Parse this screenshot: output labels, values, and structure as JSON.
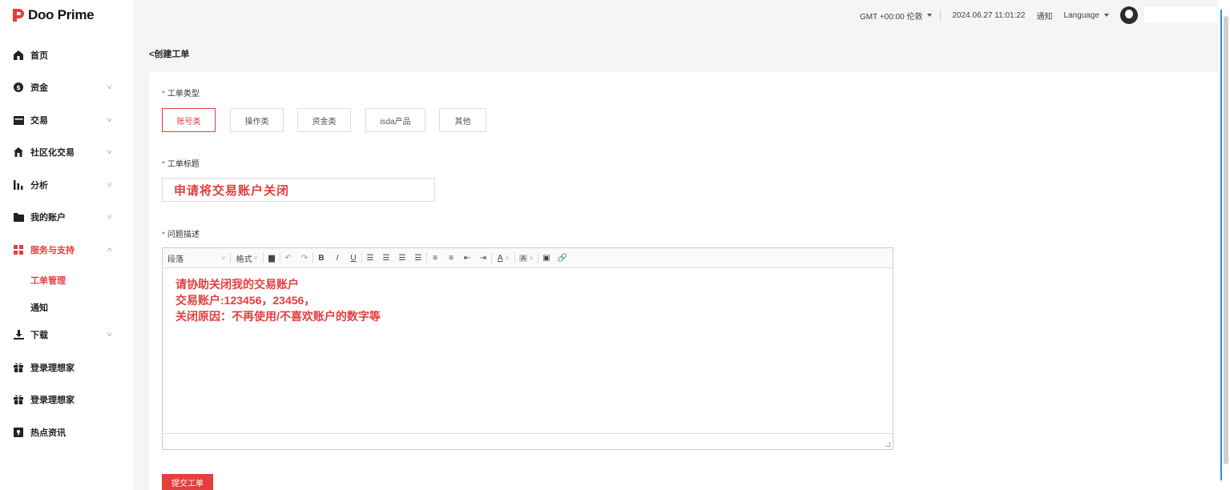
{
  "brand": {
    "name": "Doo Prime",
    "color": "#e53e3e"
  },
  "topbar": {
    "timezone": "GMT +00:00 伦敦",
    "datetime": "2024.06.27 11:01:22",
    "notice": "通知",
    "language": "Language"
  },
  "sidebar": {
    "items": [
      {
        "label": "首页",
        "icon": "home-icon"
      },
      {
        "label": "资金",
        "icon": "money-icon"
      },
      {
        "label": "交易",
        "icon": "card-icon"
      },
      {
        "label": "社区化交易",
        "icon": "house-icon"
      },
      {
        "label": "分析",
        "icon": "bars-icon"
      },
      {
        "label": "我的账户",
        "icon": "folder-icon"
      },
      {
        "label": "服务与支持",
        "icon": "grid-icon"
      },
      {
        "label": "下载",
        "icon": "download-icon"
      },
      {
        "label": "登录理想家",
        "icon": "gift-icon"
      },
      {
        "label": "登录理想家",
        "icon": "gift-icon"
      },
      {
        "label": "热点资讯",
        "icon": "news-icon"
      }
    ],
    "subitems": [
      {
        "label": "工单管理"
      },
      {
        "label": "通知"
      }
    ]
  },
  "page": {
    "back_title": "<创建工单",
    "type_label": "工单类型",
    "types": [
      "账号类",
      "操作类",
      "资金类",
      "isda产品",
      "其他"
    ],
    "selected_type": "账号类",
    "title_label": "工单标题",
    "title_value": "申请将交易账户关闭",
    "desc_label": "问题描述",
    "description": [
      "请协助关闭我的交易账户",
      "交易账户:123456，23456，",
      "关闭原因：不再使用/不喜欢账户的数字等"
    ],
    "submit": "提交工单"
  },
  "editor": {
    "paragraph": "段落",
    "format": "格式"
  }
}
